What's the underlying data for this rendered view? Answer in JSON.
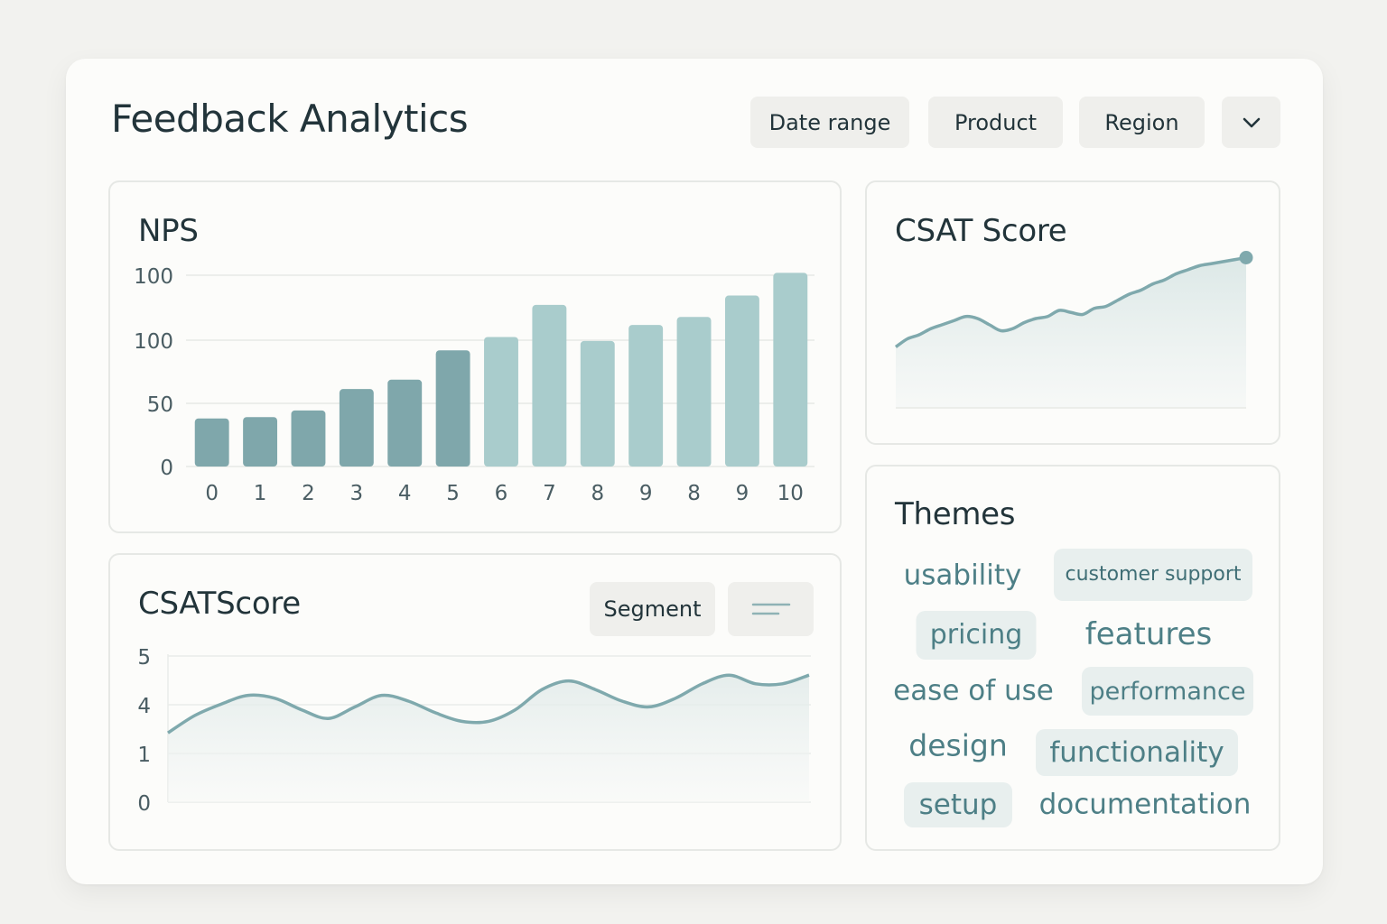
{
  "header": {
    "title": "Feedback Analytics",
    "filters": {
      "date_range": "Date range",
      "product": "Product",
      "region": "Region"
    },
    "more_icon": "chevron-down-icon"
  },
  "nps": {
    "title": "NPS",
    "chart_data": {
      "type": "bar",
      "categories": [
        "0",
        "1",
        "2",
        "3",
        "4",
        "5",
        "6",
        "7",
        "8",
        "9",
        "8",
        "9",
        "10"
      ],
      "values": [
        36,
        37,
        42,
        58,
        65,
        87,
        97,
        121,
        94,
        106,
        112,
        128,
        145
      ],
      "yticks": [
        "0",
        "50",
        "100",
        "100"
      ],
      "ylim": [
        0,
        150
      ],
      "colors": {
        "detractor": "#7fa7ab",
        "passive_promoter": "#a9cccc"
      }
    }
  },
  "csat_top": {
    "title": "CSAT Score",
    "chart_data": {
      "type": "area",
      "x": [
        0,
        1,
        2,
        3,
        4,
        5,
        6,
        7,
        8,
        9,
        10,
        11,
        12,
        13,
        14,
        15,
        16,
        17,
        18,
        19,
        20,
        21,
        22,
        23,
        24,
        25,
        26,
        27,
        28,
        29,
        30
      ],
      "values": [
        3.0,
        3.4,
        3.6,
        3.9,
        4.1,
        4.3,
        4.5,
        4.4,
        4.1,
        3.8,
        3.9,
        4.2,
        4.4,
        4.5,
        4.8,
        4.7,
        4.6,
        4.9,
        5.0,
        5.3,
        5.6,
        5.8,
        6.1,
        6.3,
        6.6,
        6.8,
        7.0,
        7.1,
        7.2,
        7.3,
        7.4
      ],
      "color": "#7fa9ad"
    }
  },
  "csat_bottom": {
    "title": "CSATScore",
    "segment_label": "Segment",
    "menu_icon": "lines-icon",
    "chart_data": {
      "type": "area",
      "yticks": [
        "0",
        "1",
        "4",
        "5"
      ],
      "x": [
        0,
        1,
        2,
        3,
        4,
        5,
        6,
        7,
        8,
        9,
        10,
        11,
        12,
        13,
        14,
        15,
        16,
        17,
        18,
        19,
        20,
        21,
        22,
        23,
        24
      ],
      "values": [
        2.4,
        3.0,
        3.4,
        3.7,
        3.6,
        3.2,
        2.9,
        3.3,
        3.7,
        3.5,
        3.1,
        2.8,
        2.8,
        3.2,
        3.9,
        4.2,
        3.9,
        3.5,
        3.3,
        3.6,
        4.1,
        4.4,
        4.1,
        4.1,
        4.4
      ],
      "color": "#7fa9ad"
    }
  },
  "themes": {
    "title": "Themes",
    "items": [
      {
        "label": "usability",
        "chip": false,
        "size": 31
      },
      {
        "label": "customer support",
        "chip": true,
        "size": 22
      },
      {
        "label": "pricing",
        "chip": true,
        "size": 30
      },
      {
        "label": "features",
        "chip": false,
        "size": 34
      },
      {
        "label": "ease of use",
        "chip": false,
        "size": 31
      },
      {
        "label": "performance",
        "chip": true,
        "size": 27
      },
      {
        "label": "design",
        "chip": false,
        "size": 33
      },
      {
        "label": "functionality",
        "chip": true,
        "size": 31
      },
      {
        "label": "setup",
        "chip": true,
        "size": 31
      },
      {
        "label": "documentation",
        "chip": false,
        "size": 31
      }
    ]
  }
}
